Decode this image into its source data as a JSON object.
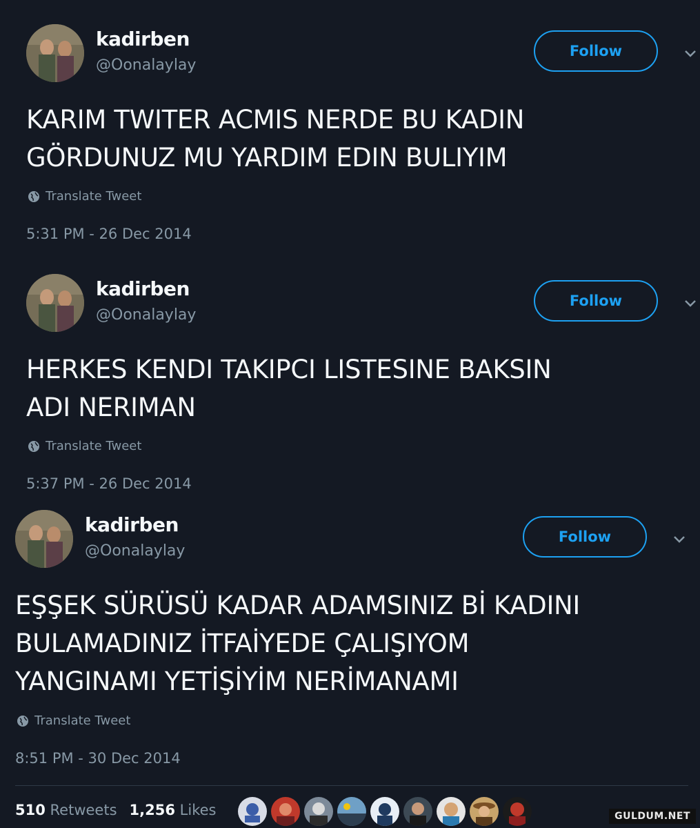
{
  "tweets": [
    {
      "display_name": "kadirben",
      "handle": "@Oonalaylay",
      "follow_label": "Follow",
      "text": "KARIM TWITER ACMIS NERDE BU KADIN\nGÖRDUNUZ MU YARDIM EDIN BULIYIM",
      "translate_label": "Translate Tweet",
      "timestamp": "5:31 PM - 26 Dec 2014"
    },
    {
      "display_name": "kadirben",
      "handle": "@Oonalaylay",
      "follow_label": "Follow",
      "text": "HERKES KENDI TAKIPCI LISTESINE BAKSIN\nADI NERIMAN",
      "translate_label": "Translate Tweet",
      "timestamp": "5:37 PM - 26 Dec 2014"
    },
    {
      "display_name": "kadirben",
      "handle": "@Oonalaylay",
      "follow_label": "Follow",
      "text": "EŞŞEK SÜRÜSÜ KADAR ADAMSINIZ Bİ KADINI\nBULAMADINIZ İTFAİYEDE ÇALIŞIYOM\nYANGINAMI YETİŞİYİM NERİMANAMI",
      "translate_label": "Translate Tweet",
      "timestamp": "8:51 PM - 30 Dec 2014"
    }
  ],
  "stats": {
    "retweets_count": "510",
    "retweets_label": "Retweets",
    "likes_count": "1,256",
    "likes_label": "Likes"
  },
  "liker_avatars": [
    "avatar-1",
    "avatar-2",
    "avatar-3",
    "avatar-4",
    "avatar-5",
    "avatar-6",
    "avatar-7",
    "avatar-8",
    "avatar-9"
  ],
  "watermark": "GULDUM.NET",
  "colors": {
    "background": "#141923",
    "accent": "#1da1f2",
    "secondary_text": "#8899a6",
    "primary_text": "#f5f8fa"
  }
}
